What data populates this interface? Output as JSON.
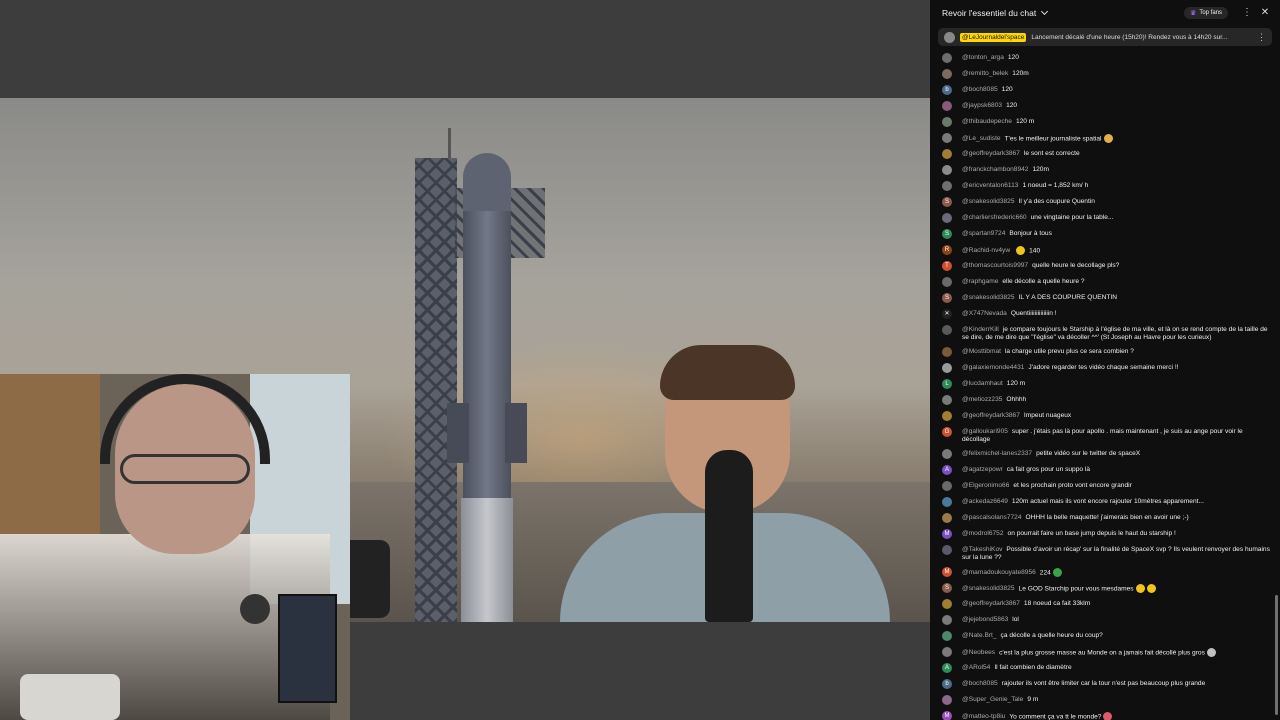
{
  "chat": {
    "header_title": "Revoir l'essentiel du chat",
    "top_fans": "Top fans",
    "pinned": {
      "author": "@LeJournaldel'space",
      "text": "Lancement décalé d'une heure (15h20)! Rendez vous à 14h20 sur..."
    },
    "messages": [
      {
        "author": "@tonton_arga",
        "text": "120",
        "avatar": "#6d6d6d",
        "initial": ""
      },
      {
        "author": "@remitto_belek",
        "text": "120m",
        "avatar": "#7a6b5e",
        "initial": ""
      },
      {
        "author": "@boch8085",
        "text": "120",
        "avatar": "#4a6c8a",
        "initial": "b"
      },
      {
        "author": "@jaypsk6803",
        "text": "120",
        "avatar": "#8a5a7a",
        "initial": ""
      },
      {
        "author": "@thibaudepeche",
        "text": "120 m",
        "avatar": "#6a7a6a",
        "initial": ""
      },
      {
        "author": "@Le_sudiste",
        "text": "T'es le meilleur journaliste spatial",
        "avatar": "#7a7a7a",
        "initial": "",
        "emoji": "#e3b14a"
      },
      {
        "author": "@geoffreydark3867",
        "text": "le sont est correcte",
        "avatar": "#a08030",
        "initial": ""
      },
      {
        "author": "@franckchambon8942",
        "text": "120m",
        "avatar": "#8b8b8b",
        "initial": ""
      },
      {
        "author": "@ericventalon6113",
        "text": "1 noeud = 1,852 km/ h",
        "avatar": "#707070",
        "initial": ""
      },
      {
        "author": "@snakesolid3825",
        "text": "Il y'a des coupure Quentin",
        "avatar": "#8a5a4a",
        "initial": "S"
      },
      {
        "author": "@charliersfrederic660",
        "text": "une vingtaine pour la table...",
        "avatar": "#6a6a7a",
        "initial": ""
      },
      {
        "author": "@spartan9724",
        "text": "Bonjour à tous",
        "avatar": "#2e8b57",
        "initial": "S"
      },
      {
        "author": "@Rachid-nv4yw",
        "text": "140",
        "avatar": "#8b4513",
        "initial": "R",
        "emoji_before": "#f0c419"
      },
      {
        "author": "@thomascourtois9997",
        "text": "quelle heure le decollage pls?",
        "avatar": "#d05030",
        "initial": "T"
      },
      {
        "author": "@raphgame",
        "text": "elle décolle a quelle heure ?",
        "avatar": "#6a6a6a",
        "initial": ""
      },
      {
        "author": "@snakesolid3825",
        "text": "IL Y A DES COUPURE QUENTIN",
        "avatar": "#8a5a4a",
        "initial": "S"
      },
      {
        "author": "@X747Nevada",
        "text": "Quentiiiiiiiiiiiiiin !",
        "avatar": "#222222",
        "initial": "✕"
      },
      {
        "author": "@KinderrKill",
        "text": "je compare toujours le Starship à l'église de ma ville, et là on se rend compte de la taille de se dire, de me dire que \"l'église\" va décoller ^^' (St Joseph au Havre pour les curieux)",
        "avatar": "#5a5a5a",
        "initial": "",
        "two": true
      },
      {
        "author": "@Mosttibmat",
        "text": "la charge utile prevu plus ce sera combien ?",
        "avatar": "#7a5a3a",
        "initial": ""
      },
      {
        "author": "@galaxiemonde4431",
        "text": "J'adore regarder tes vidéo chaque semaine merci !!",
        "avatar": "#9a9a9a",
        "initial": ""
      },
      {
        "author": "@lucdamhaut",
        "text": "120 m",
        "avatar": "#2e8b57",
        "initial": "L"
      },
      {
        "author": "@metiozz235",
        "text": "Ohhhh",
        "avatar": "#7a7a7a",
        "initial": ""
      },
      {
        "author": "@geoffreydark3867",
        "text": "Impeut nuageux",
        "avatar": "#a08030",
        "initial": ""
      },
      {
        "author": "@galloukari905",
        "text": "super . j'étais pas là pour apollo . mais maintenant , je suis au ange pour voir le décollage",
        "avatar": "#d05030",
        "initial": "G",
        "two": true
      },
      {
        "author": "@felixmichel-lanes2337",
        "text": "petite vidéo sur le twitter de spaceX",
        "avatar": "#7a7a7a",
        "initial": ""
      },
      {
        "author": "@agatzepowr",
        "text": "ca fait gros pour un suppo là",
        "avatar": "#7b4fc4",
        "initial": "A"
      },
      {
        "author": "@Elgeronimo66",
        "text": "et les prochain proto vont encore grandir",
        "avatar": "#6a6a6a",
        "initial": ""
      },
      {
        "author": "@ackedaz6649",
        "text": "120m actuel mais ils vont encore rajouter 10mètres apparement...",
        "avatar": "#4a7a9a",
        "initial": ""
      },
      {
        "author": "@pascalsolans7724",
        "text": "OHHH la belle maquette! j'aimerais bien en avoir une ;-)",
        "avatar": "#9a7a4a",
        "initial": ""
      },
      {
        "author": "@modrol6752",
        "text": "on pourrait faire un base jump depuis le haut du starship !",
        "avatar": "#7b4fc4",
        "initial": "M"
      },
      {
        "author": "@TakeshiKov",
        "text": "Possible d'avoir un récap' sur la finalité de SpaceX svp ? Ils veulent renvoyer des humains sur la lune ??",
        "avatar": "#5a5a6a",
        "initial": "",
        "two": true
      },
      {
        "author": "@mamadoukouyate8956",
        "text": "224",
        "avatar": "#d05030",
        "initial": "M",
        "emoji": "#3aa34a"
      },
      {
        "author": "@snakesolid3825",
        "text": "Le GOD Starchip pour vous mesdames",
        "avatar": "#8a5a4a",
        "initial": "S",
        "emoji": "#f0c419",
        "emoji2": "#f0c419"
      },
      {
        "author": "@geoffreydark3867",
        "text": "18 noeud ca fait 33klm",
        "avatar": "#a08030",
        "initial": ""
      },
      {
        "author": "@jejebond5863",
        "text": "lol",
        "avatar": "#7a7a7a",
        "initial": ""
      },
      {
        "author": "@Nate.Brt_",
        "text": "ça décolle a quelle heure du coup?",
        "avatar": "#4a8a6a",
        "initial": ""
      },
      {
        "author": "@Neobees",
        "text": "c'est la plus grosse masse au Monde on a jamais fait décollé plus gros",
        "avatar": "#7a7a7a",
        "initial": "",
        "emoji": "#c0c0c0"
      },
      {
        "author": "@ARol54",
        "text": "Il fait combien de diamètre",
        "avatar": "#2e8b57",
        "initial": "A"
      },
      {
        "author": "@boch8085",
        "text": "rajouter ils vont être limiter car la tour n'est pas beaucoup plus grande",
        "avatar": "#4a6c8a",
        "initial": "b"
      },
      {
        "author": "@Super_Genie_Tale",
        "text": "9 m",
        "avatar": "#8a6a8a",
        "initial": ""
      },
      {
        "author": "@matteo-tp8iu",
        "text": "Yo comment ça va tt le monde?",
        "avatar": "#9a4fb4",
        "initial": "M",
        "emoji": "#e05a6a"
      }
    ]
  }
}
